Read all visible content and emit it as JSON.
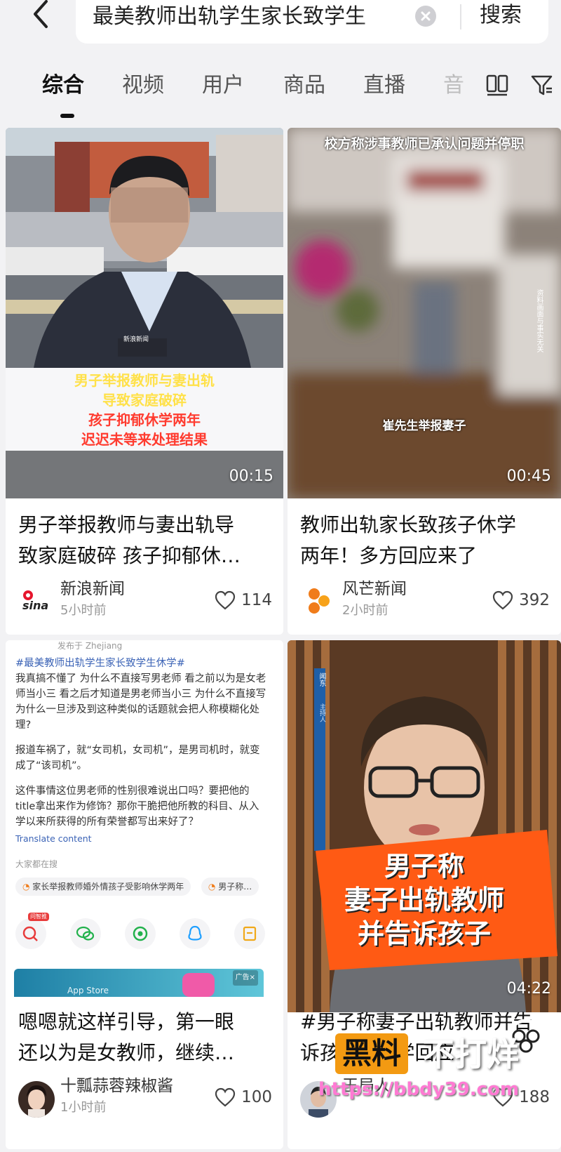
{
  "search": {
    "query": "最美教师出轨学生家长致学生",
    "button_label": "搜索"
  },
  "tabs": [
    {
      "label": "综合"
    },
    {
      "label": "视频"
    },
    {
      "label": "用户"
    },
    {
      "label": "商品"
    },
    {
      "label": "直播"
    },
    {
      "label": "音"
    }
  ],
  "cards": [
    {
      "title_line1": "男子举报教师与妻出轨导",
      "title_line2": "致家庭破碎 孩子抑郁休…",
      "author": "新浪新闻",
      "time": "5小时前",
      "likes": "114",
      "duration": "00:15",
      "logo_text": "sina",
      "overlay_badge": "新浪新闻",
      "caption_lines": [
        "男子举报教师与妻出轨",
        "导致家庭破碎",
        "孩子抑郁休学两年",
        "迟迟未等来处理结果"
      ]
    },
    {
      "title_line1": "教师出轨家长致孩子休学",
      "title_line2": "两年！多方回应来了",
      "author": "风芒新闻",
      "time": "2小时前",
      "likes": "392",
      "duration": "00:45",
      "top_caption": "校方称涉事教师已承认问题并停职",
      "bottom_caption": "崔先生举报妻子",
      "side_note": "资料画面与事实无关"
    },
    {
      "title_line1": "嗯嗯就这样引导，第一眼",
      "title_line2": "还以为是女教师，继续…",
      "author": "十瓢蒜蓉辣椒酱",
      "time": "1小时前",
      "likes": "100",
      "doc": {
        "published": "发布于 Zhejiang",
        "hashtag": "#最美教师出轨学生家长致学生休学#",
        "p1": "我真搞不懂了 为什么不直接写男老师 看之前以为是女老师当小三 看之后才知道是男老师当小三 为什么不直接写 为什么一旦涉及到这种类似的话题就会把人称模糊化处理?",
        "p2": "报道车祸了，就“女司机，女司机”，是男司机时，就变成了“该司机”。",
        "p3": "这件事情这位男老师的性别很难说出口吗？要把他的title拿出来作为修饰？那你干脆把他所教的科目、从入学以来所获得的所有荣誉都写出来好了？",
        "translate": "Translate content",
        "everyone_searching": "大家都在搜",
        "chip1": "家长举报教师婚外情孩子受影响休学两年",
        "chip2": "男子称…",
        "ad_tag": "广告×",
        "app_store": "App Store",
        "hot_label": "问智推"
      }
    },
    {
      "title_line1": "#男子称妻子出轨教师并告",
      "title_line2": "诉孩子#中学回应",
      "author": "王局人",
      "time": "",
      "likes": "188",
      "duration": "04:22",
      "caption_lines": [
        "男子称",
        "妻子出轨教师",
        "并告诉孩子"
      ],
      "side_label": "闻东",
      "side_label2": "主持人"
    }
  ],
  "watermark": {
    "brand": "黑料",
    "slogan": "不打烊",
    "url": "https://bbdy39.com"
  },
  "colors": {
    "accent_orange": "#f07c1a",
    "caption_yellow": "#ffe14a",
    "caption_red": "#ff3b2f",
    "hashtag_blue": "#3b63b6"
  }
}
